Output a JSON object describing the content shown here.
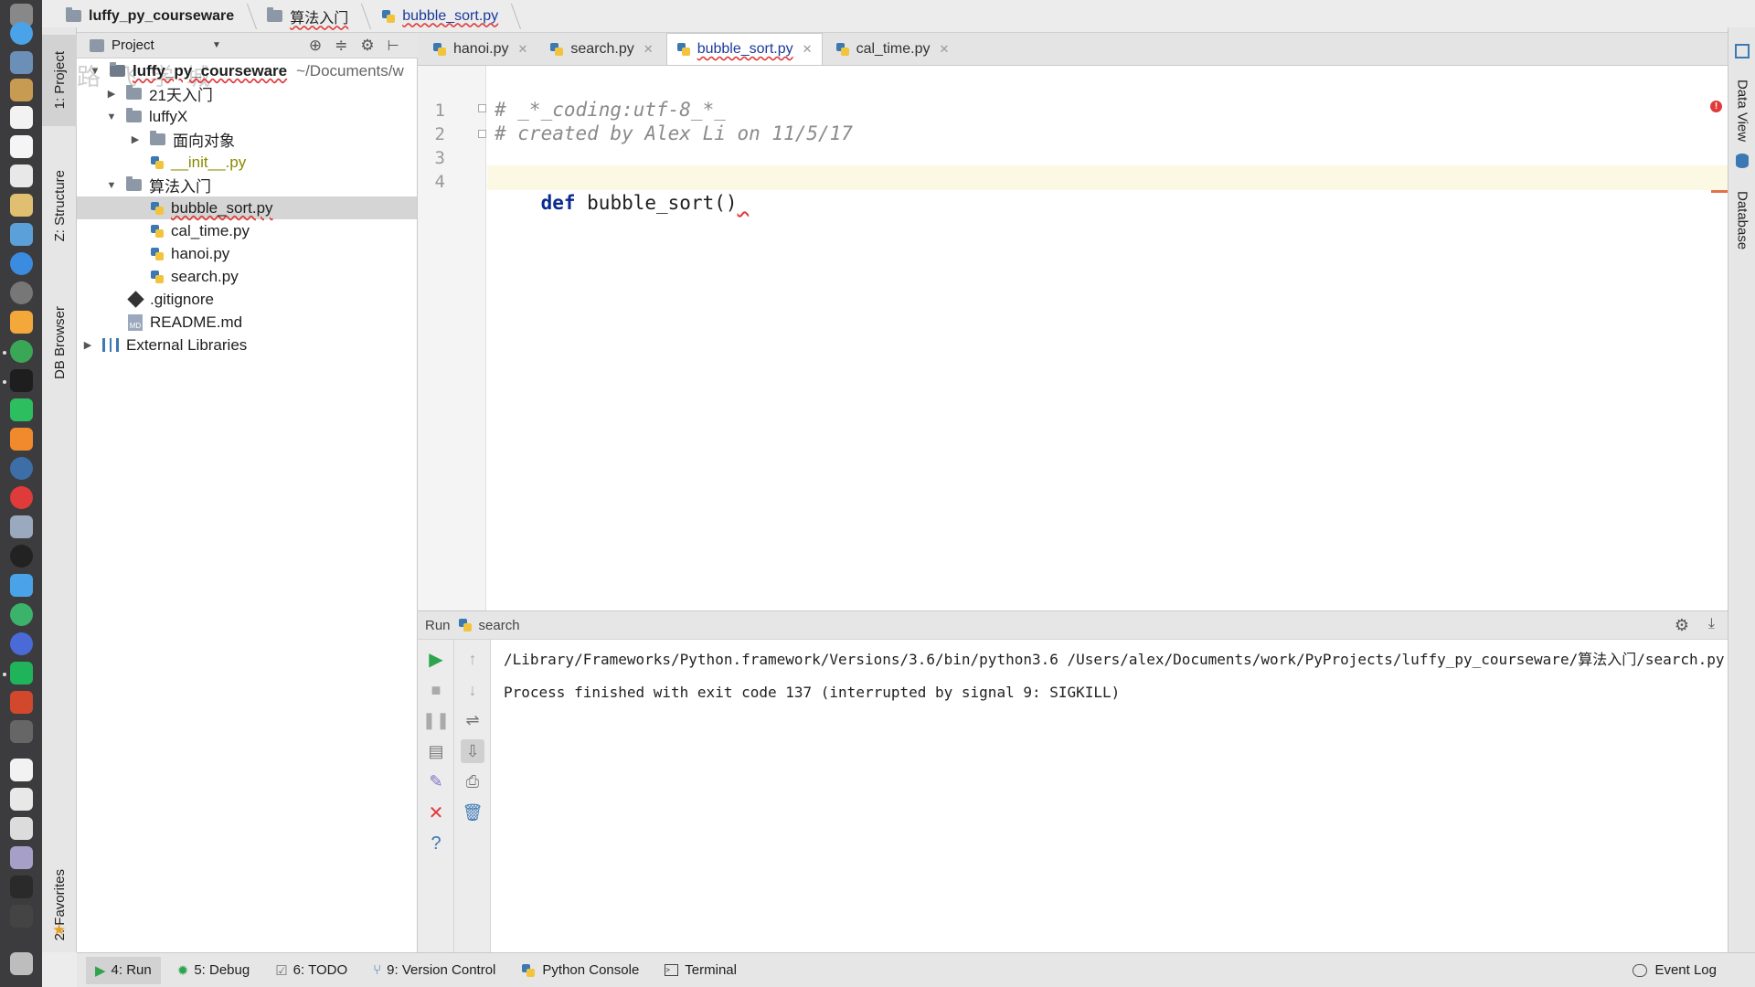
{
  "breadcrumb": [
    "luffy_py_courseware",
    "算法入门",
    "bubble_sort.py"
  ],
  "project_panel": {
    "selector_label": "Project",
    "root_name": "luffy_py_courseware",
    "root_path": "~/Documents/w",
    "watermark": "路飞学城",
    "tree": [
      {
        "label": "21天入门",
        "kind": "folder",
        "expanded": false
      },
      {
        "label": "luffyX",
        "kind": "folder",
        "expanded": true
      },
      {
        "label": "面向对象",
        "kind": "folder",
        "expanded": false
      },
      {
        "label": "__init__.py",
        "kind": "py"
      },
      {
        "label": "算法入门",
        "kind": "folder",
        "expanded": true
      },
      {
        "label": "bubble_sort.py",
        "kind": "py",
        "selected": true
      },
      {
        "label": "cal_time.py",
        "kind": "py"
      },
      {
        "label": "hanoi.py",
        "kind": "py"
      },
      {
        "label": "search.py",
        "kind": "py"
      },
      {
        "label": ".gitignore",
        "kind": "git"
      },
      {
        "label": "README.md",
        "kind": "md"
      },
      {
        "label": "External Libraries",
        "kind": "lib",
        "expanded": false
      }
    ]
  },
  "left_strip": {
    "project": "1: Project",
    "structure": "Z: Structure",
    "db_browser": "DB Browser",
    "favorites": "2: Favorites"
  },
  "right_strip": {
    "data_view": "Data View",
    "database": "Database"
  },
  "tabs": [
    {
      "label": "hanoi.py",
      "active": false
    },
    {
      "label": "search.py",
      "active": false
    },
    {
      "label": "bubble_sort.py",
      "active": true
    },
    {
      "label": "cal_time.py",
      "active": false
    }
  ],
  "editor": {
    "line_numbers": [
      "1",
      "2",
      "3",
      "4"
    ],
    "lines": {
      "l1": "# _*_coding:utf-8_*_",
      "l2": "# created by Alex Li on 11/5/17",
      "l3": "",
      "l4_kw": "def",
      "l4_rest": " bubble_sort()"
    }
  },
  "run": {
    "label": "Run",
    "config": "search",
    "output": [
      "/Library/Frameworks/Python.framework/Versions/3.6/bin/python3.6 /Users/alex/Documents/work/PyProjects/luffy_py_courseware/算法入门/search.py",
      "Process finished with exit code 137 (interrupted by signal 9: SIGKILL)"
    ]
  },
  "statusbar": {
    "run": "4: Run",
    "debug": "5: Debug",
    "todo": "6: TODO",
    "vcs": "9: Version Control",
    "python_console": "Python Console",
    "terminal": "Terminal",
    "event_log": "Event Log"
  },
  "colors": {
    "accent": "#1b3a9a",
    "keyword": "#0a2b8f",
    "error": "#e03b3b"
  }
}
